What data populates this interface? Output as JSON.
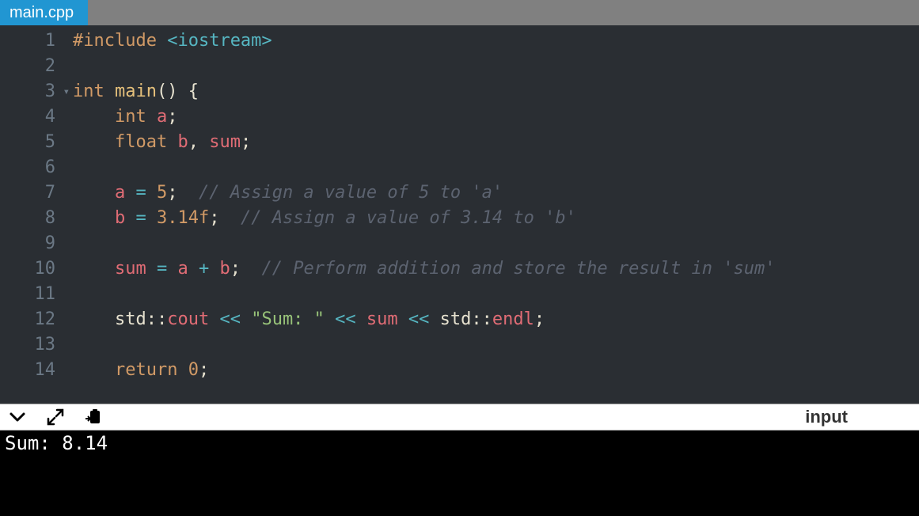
{
  "tab": {
    "title": "main.cpp"
  },
  "code": {
    "l1": {
      "kw": "#include",
      "ang": "<iostream>"
    },
    "l3": {
      "kw1": "int",
      "fn": "main",
      "rest": "() {"
    },
    "l4": {
      "kw": "int",
      "id": "a",
      "semi": ";"
    },
    "l5": {
      "kw": "float",
      "id1": "b",
      "comma": ",",
      "id2": "sum",
      "semi": ";"
    },
    "l7": {
      "id": "a",
      "eq": "=",
      "num": "5",
      "semi": ";",
      "com": "// Assign a value of 5 to 'a'"
    },
    "l8": {
      "id": "b",
      "eq": "=",
      "num": "3.14f",
      "semi": ";",
      "com": "// Assign a value of 3.14 to 'b'"
    },
    "l10": {
      "id1": "sum",
      "eq": "=",
      "id2": "a",
      "plus": "+",
      "id3": "b",
      "semi": ";",
      "com": "// Perform addition and store the result in 'sum'"
    },
    "l12": {
      "ns": "std::",
      "cout": "cout",
      "ins1": "<<",
      "str": "\"Sum: \"",
      "ins2": "<<",
      "sum": "sum",
      "ins3": "<<",
      "ns2": "std::",
      "endl": "endl",
      "semi": ";"
    },
    "l14": {
      "kw": "return",
      "num": "0",
      "semi": ";"
    }
  },
  "gutter": [
    "1",
    "2",
    "3",
    "4",
    "5",
    "6",
    "7",
    "8",
    "9",
    "10",
    "11",
    "12",
    "13",
    "14"
  ],
  "toolbar": {
    "input_label": "input"
  },
  "console": {
    "output": "Sum: 8.14"
  }
}
